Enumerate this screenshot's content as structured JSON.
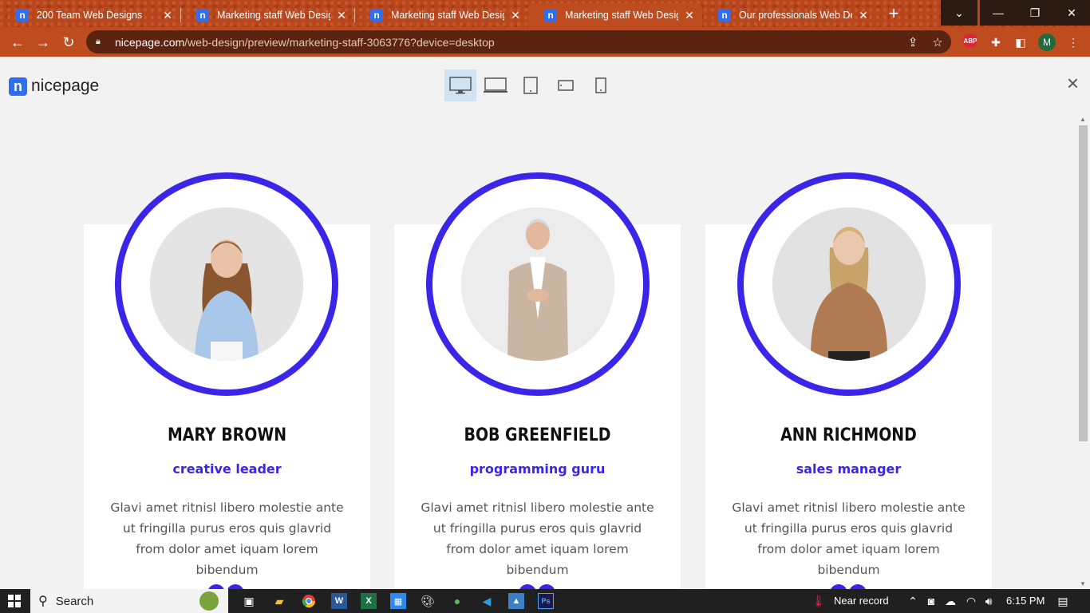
{
  "browser": {
    "tabs": [
      {
        "title": "200 Team Web Designs",
        "active": false
      },
      {
        "title": "Marketing staff Web Design",
        "active": false
      },
      {
        "title": "Marketing staff Web Design",
        "active": false
      },
      {
        "title": "Marketing staff Web Design",
        "active": true
      },
      {
        "title": "Our professionals Web Desig",
        "active": false
      }
    ],
    "favicon_letter": "n",
    "new_tab": "+",
    "url_host": "nicepage.com",
    "url_path": "/web-design/preview/marketing-staff-3063776?device=desktop",
    "profile_initial": "M",
    "abp_badge": "ABP",
    "icons": [
      "back-icon",
      "forward-icon",
      "reload-icon",
      "lock-icon",
      "share-icon",
      "star-icon",
      "extensions-icon",
      "sidepanel-icon",
      "menu-icon"
    ]
  },
  "preview": {
    "logo_mark": "n",
    "logo_text": "nicepage",
    "devices": [
      "desktop",
      "laptop",
      "tablet",
      "tablet-landscape",
      "phone"
    ],
    "selected_device": "desktop",
    "close": "×"
  },
  "team": [
    {
      "name": "MARY BROWN",
      "role": "creative leader",
      "bio": "Glavi amet ritnisl libero molestie ante ut fringilla purus eros quis glavrid from dolor amet iquam lorem bibendum"
    },
    {
      "name": "BOB GREENFIELD",
      "role": "programming guru",
      "bio": "Glavi amet ritnisl libero molestie ante ut fringilla purus eros quis glavrid from dolor amet iquam lorem bibendum"
    },
    {
      "name": "ANN RICHMOND",
      "role": "sales manager",
      "bio": "Glavi amet ritnisl libero molestie ante ut fringilla purus eros quis glavrid from dolor amet iquam lorem bibendum"
    }
  ],
  "colors": {
    "accent": "#3a26e8",
    "browser_frame": "#bf4c1f",
    "card": "#ffffff",
    "page": "#f2f2f2"
  },
  "taskbar": {
    "search": "Search",
    "weather": "Near record",
    "time": "6:15 PM",
    "apps": [
      "task-view-icon",
      "file-explorer-icon",
      "chrome-icon",
      "word-icon",
      "excel-icon",
      "store-icon",
      "paint-icon",
      "app-icon",
      "vscode-icon",
      "photos-icon",
      "photoshop-icon"
    ]
  }
}
